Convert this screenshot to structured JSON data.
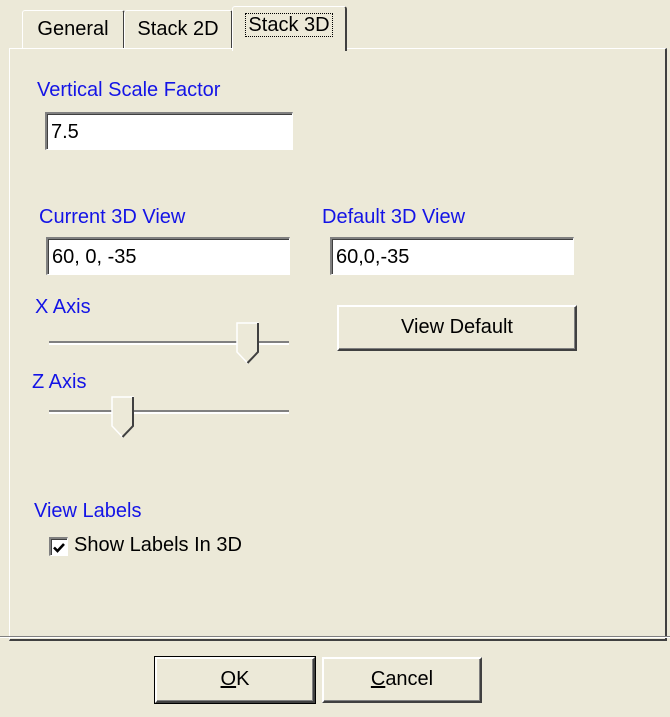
{
  "tabs": [
    {
      "label": "General",
      "active": false
    },
    {
      "label": "Stack 2D",
      "active": false
    },
    {
      "label": "Stack 3D",
      "active": true
    }
  ],
  "vertical_scale": {
    "label": "Vertical Scale Factor",
    "value": "7.5"
  },
  "current_view": {
    "label": "Current 3D View",
    "value": "60, 0, -35"
  },
  "default_view": {
    "label": "Default 3D View",
    "value": "60,0,-35"
  },
  "x_axis": {
    "label": "X Axis",
    "slider_level": 0.83
  },
  "z_axis": {
    "label": "Z Axis",
    "slider_level": 0.31
  },
  "view_default_button": "View Default",
  "view_labels": {
    "label": "View Labels",
    "checkbox_label": "Show Labels In 3D",
    "checked": true
  },
  "buttons": {
    "ok_mnemonic": "O",
    "ok_rest": "K",
    "cancel_mnemonic": "C",
    "cancel_rest": "ancel"
  },
  "colors": {
    "group_label": "#1414e6",
    "dialog_bg": "#ece9d8"
  }
}
